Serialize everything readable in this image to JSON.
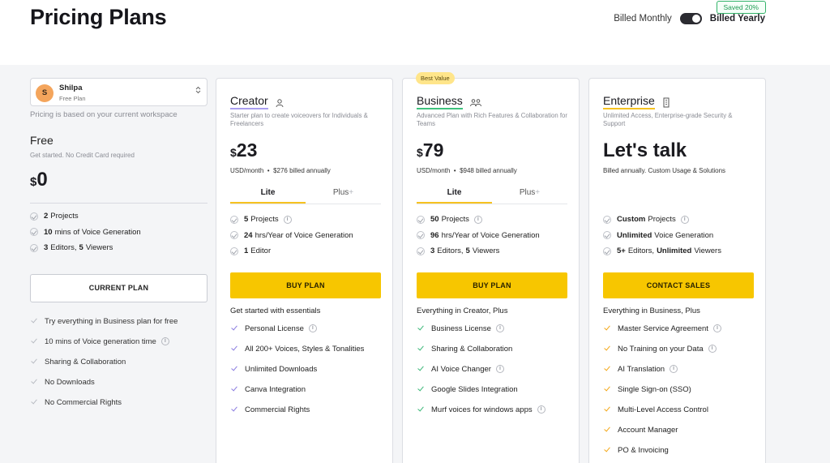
{
  "header": {
    "title": "Pricing Plans",
    "billed_monthly": "Billed Monthly",
    "billed_yearly": "Billed Yearly",
    "saved_badge": "Saved 20%"
  },
  "workspace": {
    "avatar_initial": "S",
    "name": "Shilpa",
    "plan": "Free Plan",
    "chevron": "⌃⌄",
    "note": "Pricing is based on your current workspace"
  },
  "free": {
    "name": "Free",
    "desc": "Get started. No Credit Card required",
    "currency": "$",
    "price": "0",
    "features": [
      {
        "bold": "2",
        "text": "Projects"
      },
      {
        "bold": "10",
        "text": "mins of Voice Generation"
      },
      {
        "bold": "3",
        "text": "Editors,",
        "bold2": "5",
        "text2": "Viewers"
      }
    ],
    "cta": "CURRENT PLAN",
    "perks": [
      "Try everything in Business plan for free",
      "10 mins of Voice generation time",
      "Sharing & Collaboration",
      "No Downloads",
      "No Commercial Rights"
    ]
  },
  "creator": {
    "name": "Creator",
    "desc": "Starter plan to create voiceovers for Individuals & Freelancers",
    "currency": "$",
    "price": "23",
    "price_unit": "USD/month",
    "billed_note": "$276 billed annually",
    "tab_lite": "Lite",
    "tab_plus": "Plus",
    "features": [
      {
        "bold": "5",
        "text": "Projects"
      },
      {
        "bold": "24",
        "text": "hrs/Year of Voice Generation"
      },
      {
        "bold": "1",
        "text": "Editor"
      }
    ],
    "cta": "BUY PLAN",
    "perks_head": "Get started with essentials",
    "perks": [
      "Personal License",
      "All 200+ Voices, Styles & Tonalities",
      "Unlimited Downloads",
      "Canva Integration",
      "Commercial Rights"
    ]
  },
  "business": {
    "badge": "Best Value",
    "name": "Business",
    "desc": "Advanced Plan with Rich Features & Collaboration for Teams",
    "currency": "$",
    "price": "79",
    "price_unit": "USD/month",
    "billed_note": "$948 billed annually",
    "tab_lite": "Lite",
    "tab_plus": "Plus",
    "features": [
      {
        "bold": "50",
        "text": "Projects"
      },
      {
        "bold": "96",
        "text": "hrs/Year of Voice Generation"
      },
      {
        "bold": "3",
        "text": "Editors,",
        "bold2": "5",
        "text2": "Viewers"
      }
    ],
    "cta": "BUY PLAN",
    "perks_head": "Everything in Creator, Plus",
    "perks": [
      "Business License",
      "Sharing & Collaboration",
      "AI Voice Changer",
      "Google Slides Integration",
      "Murf voices for windows apps"
    ]
  },
  "enterprise": {
    "name": "Enterprise",
    "desc": "Unlimited Access, Enterprise-grade Security & Support",
    "price": "Let's talk",
    "billed_note": "Billed annually. Custom Usage & Solutions",
    "features": [
      {
        "bold": "Custom",
        "text": "Projects"
      },
      {
        "bold": "Unlimited",
        "text": "Voice Generation"
      },
      {
        "bold": "5+",
        "text": "Editors,",
        "bold2": "Unlimited",
        "text2": "Viewers"
      }
    ],
    "cta": "CONTACT SALES",
    "perks_head": "Everything in Business, Plus",
    "perks": [
      "Master Service Agreement",
      "No Training on your Data",
      "AI Translation",
      "Single Sign-on (SSO)",
      "Multi-Level Access Control",
      "Account Manager",
      "PO & Invoicing"
    ]
  },
  "icons": {
    "info": "i",
    "plus": "+"
  },
  "colors": {
    "accent_yellow": "#f7c600",
    "creator_accent": "#a99ef0",
    "business_accent": "#3ec27d",
    "enterprise_accent": "#f6c220",
    "saved_green": "#229a55"
  }
}
